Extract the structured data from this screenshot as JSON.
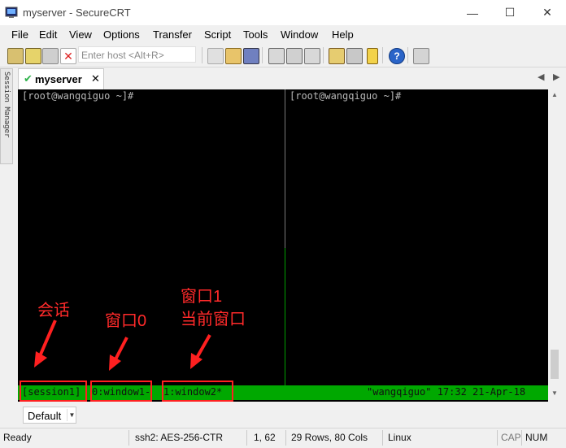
{
  "window": {
    "title": "myserver - SecureCRT",
    "minimize_glyph": "—",
    "maximize_glyph": "☐",
    "close_glyph": "✕"
  },
  "menu": [
    "File",
    "Edit",
    "View",
    "Options",
    "Transfer",
    "Script",
    "Tools",
    "Window",
    "Help"
  ],
  "toolbar": {
    "host_placeholder": "Enter host <Alt+R>"
  },
  "session_manager": {
    "label": "Session Manager"
  },
  "tabs": [
    {
      "label": "myserver",
      "close_glyph": "✕",
      "check_glyph": "✔"
    }
  ],
  "tab_nav": {
    "prev_glyph": "◀",
    "next_glyph": "▶"
  },
  "terminal": {
    "left_prompt": "[root@wangqiguo ~]#",
    "right_prompt": "[root@wangqiguo ~]#",
    "status_line": {
      "session": "[session1]",
      "window0": "0:window1-",
      "window1": "1:window2*",
      "right": "\"wangqiguo\" 17:32 21-Apr-18"
    }
  },
  "annotations": {
    "session": "会话",
    "window0": "窗口0",
    "window1_line1": "窗口1",
    "window1_line2": "当前窗口"
  },
  "command_bar": {
    "selected": "Default"
  },
  "statusbar": {
    "ready": "Ready",
    "cipher": "ssh2: AES-256-CTR",
    "position": "1,  62",
    "size": "29 Rows, 80 Cols",
    "os": "Linux",
    "cap": "CAP",
    "num": "NUM"
  },
  "colors": {
    "terminal_bg": "#000000",
    "terminal_fg": "#b8b8b8",
    "status_green": "#00a800",
    "annotation_red": "#ff2020"
  }
}
